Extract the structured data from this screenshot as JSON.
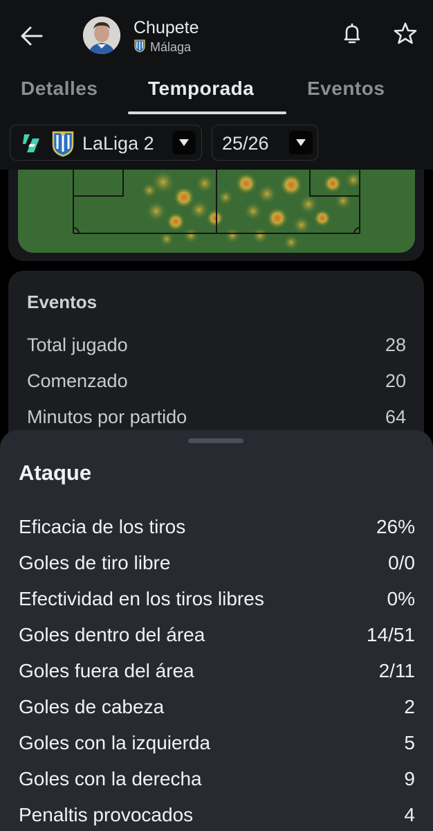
{
  "header": {
    "player_name": "Chupete",
    "team_name": "Málaga"
  },
  "tabs": [
    "Detalles",
    "Temporada",
    "Eventos"
  ],
  "active_tab": "Temporada",
  "filters": {
    "competition": "LaLiga 2",
    "season": "25/26"
  },
  "events_section": {
    "title": "Eventos",
    "rows": [
      {
        "label": "Total jugado",
        "value": "28"
      },
      {
        "label": "Comenzado",
        "value": "20"
      },
      {
        "label": "Minutos por partido",
        "value": "64"
      }
    ]
  },
  "attack_sheet": {
    "title": "Ataque",
    "rows": [
      {
        "label": "Eficacia de los tiros",
        "value": "26%"
      },
      {
        "label": "Goles de tiro libre",
        "value": "0/0"
      },
      {
        "label": "Efectividad en los tiros libres",
        "value": "0%"
      },
      {
        "label": "Goles dentro del área",
        "value": "14/51"
      },
      {
        "label": "Goles fuera del área",
        "value": "2/11"
      },
      {
        "label": "Goles de cabeza",
        "value": "2"
      },
      {
        "label": "Goles con la izquierda",
        "value": "5"
      },
      {
        "label": "Goles con la derecha",
        "value": "9"
      },
      {
        "label": "Penaltis provocados",
        "value": "4"
      }
    ]
  },
  "colors": {
    "background": "#000000",
    "header": "#111214",
    "card": "#1b1d21",
    "sheet": "#272a30",
    "pitch": "#3a6b34",
    "laliga_accent": "#3ed3b0",
    "malaga_blue": "#2a6fc0"
  },
  "icons": [
    "back-arrow-icon",
    "bell-icon",
    "star-icon",
    "laliga-logo-icon",
    "malaga-crest-icon",
    "dropdown-caret-icon"
  ]
}
